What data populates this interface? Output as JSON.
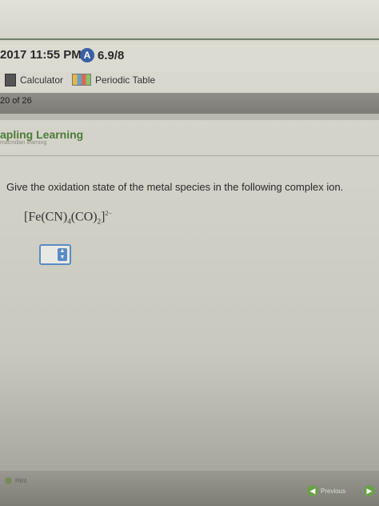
{
  "header": {
    "datetime": "2017 11:55 PM",
    "score_icon": "A",
    "score": "6.9/8"
  },
  "toolbar": {
    "calculator_label": "Calculator",
    "periodic_table_label": "Periodic Table"
  },
  "pagination": {
    "label": "20 of 26"
  },
  "brand": {
    "title": "apling Learning",
    "subtitle": "macmillan learning"
  },
  "question": {
    "prompt": "Give the oxidation state of the metal species in the following complex ion.",
    "formula": {
      "open": "[Fe(CN)",
      "cn_sub": "4",
      "mid": "(CO)",
      "co_sub": "2",
      "close": "]",
      "charge": "2−"
    },
    "answer_value": ""
  },
  "footer": {
    "hint_label": "Hint",
    "previous_label": "Previous"
  },
  "colors": {
    "accent": "#5a8cc4",
    "brand_green": "#4c7b3a"
  }
}
